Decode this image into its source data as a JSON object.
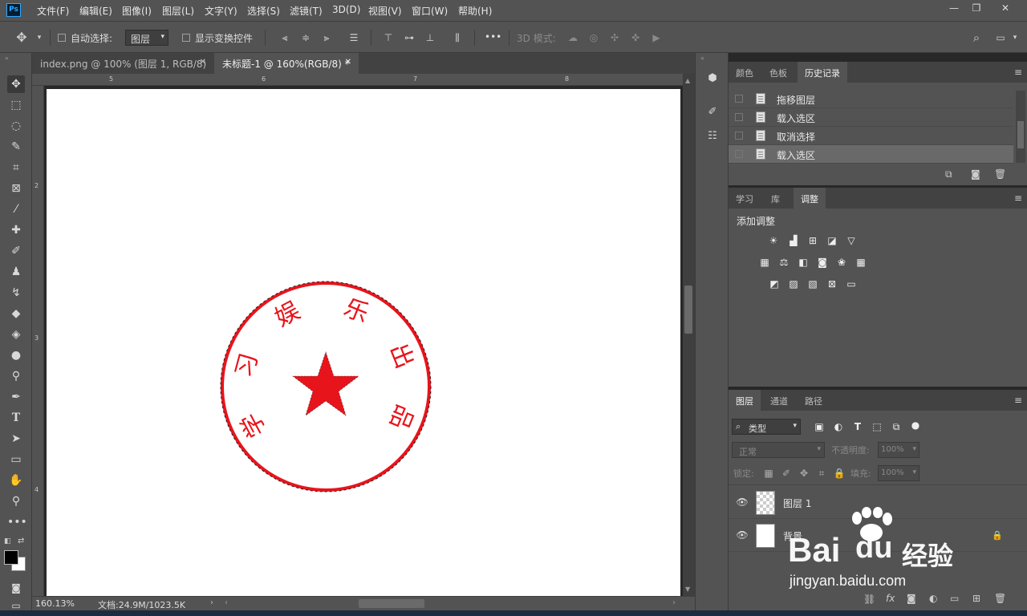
{
  "app": {
    "logo": "Ps"
  },
  "menu": [
    "文件(F)",
    "编辑(E)",
    "图像(I)",
    "图层(L)",
    "文字(Y)",
    "选择(S)",
    "滤镜(T)",
    "3D(D)",
    "视图(V)",
    "窗口(W)",
    "帮助(H)"
  ],
  "window_controls": {
    "minimize": "—",
    "restore": "❐",
    "close": "✕"
  },
  "options": {
    "auto_select_label": "自动选择:",
    "auto_select_value": "图层",
    "show_transform_label": "显示变换控件",
    "more": "•••",
    "mode_3d_label": "3D 模式:"
  },
  "doc_tabs": [
    {
      "title": "index.png @ 100% (图层 1, RGB/8)",
      "close": "✕"
    },
    {
      "title": "未标题-1 @ 160%(RGB/8) *",
      "close": "✕"
    }
  ],
  "ruler": {
    "h_labels": [
      "5",
      "6",
      "7",
      "8"
    ],
    "v_labels": [
      "2",
      "3",
      "4"
    ]
  },
  "status": {
    "zoom": "160.13%",
    "doc_info": "文档:24.9M/1023.5K"
  },
  "stamp": {
    "color": "#e8141b",
    "chars": [
      "习",
      "娱",
      "乐",
      "出",
      "品",
      "学"
    ]
  },
  "history_panel": {
    "tabs": [
      "颜色",
      "色板",
      "历史记录"
    ],
    "items": [
      "拖移图层",
      "载入选区",
      "取消选择",
      "载入选区"
    ],
    "active_index": 3
  },
  "adjust_panel": {
    "tabs": [
      "学习",
      "库",
      "调整"
    ],
    "title": "添加调整"
  },
  "layers_panel": {
    "tabs": [
      "图层",
      "通道",
      "路径"
    ],
    "filter_label": "类型",
    "blend_mode": "正常",
    "opacity_label": "不透明度:",
    "opacity_value": "100%",
    "lock_label": "锁定:",
    "fill_label": "填充:",
    "fill_value": "100%",
    "layers": [
      {
        "name": "图层 1"
      },
      {
        "name": "背景"
      }
    ]
  },
  "watermark": {
    "logo": "Bai",
    "paw": "du",
    "brand": "经验",
    "url": "jingyan.baidu.com"
  }
}
